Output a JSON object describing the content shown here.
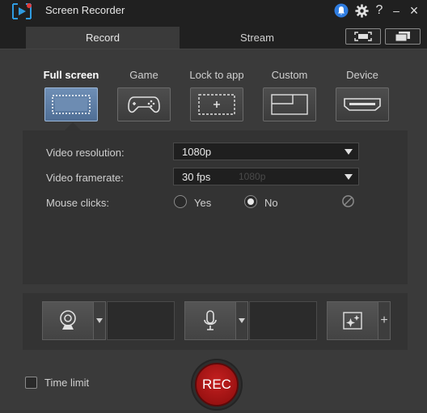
{
  "app": {
    "title": "Screen Recorder",
    "help_glyph": "?",
    "minimize_glyph": "–",
    "close_glyph": "×"
  },
  "tabs": [
    {
      "label": "Record",
      "active": true
    },
    {
      "label": "Stream",
      "active": false
    }
  ],
  "capture_modes": [
    {
      "label": "Full screen",
      "icon": "monitor-icon",
      "active": true
    },
    {
      "label": "Game",
      "icon": "gamepad-icon",
      "active": false
    },
    {
      "label": "Lock to app",
      "icon": "lock-app-icon",
      "active": false
    },
    {
      "label": "Custom",
      "icon": "custom-region-icon",
      "active": false
    },
    {
      "label": "Device",
      "icon": "hdmi-device-icon",
      "active": false
    }
  ],
  "settings": {
    "resolution_label": "Video resolution:",
    "resolution_value": "1080p",
    "framerate_label": "Video framerate:",
    "framerate_value": "30 fps",
    "framerate_ghost": "1080p",
    "mouse_clicks_label": "Mouse clicks:",
    "mouse_options": [
      {
        "label": "Yes",
        "checked": false
      },
      {
        "label": "No",
        "checked": true
      }
    ]
  },
  "devices": {
    "webcam_icon": "webcam-icon",
    "mic_icon": "microphone-icon",
    "effects_icon": "sparkle-effects-icon",
    "add_glyph": "+"
  },
  "footer": {
    "time_limit_label": "Time limit",
    "time_limit_checked": false,
    "rec_label": "REC"
  },
  "colors": {
    "accent": "#5b7aa3",
    "rec": "#b81818",
    "notification": "#2f7de1"
  }
}
